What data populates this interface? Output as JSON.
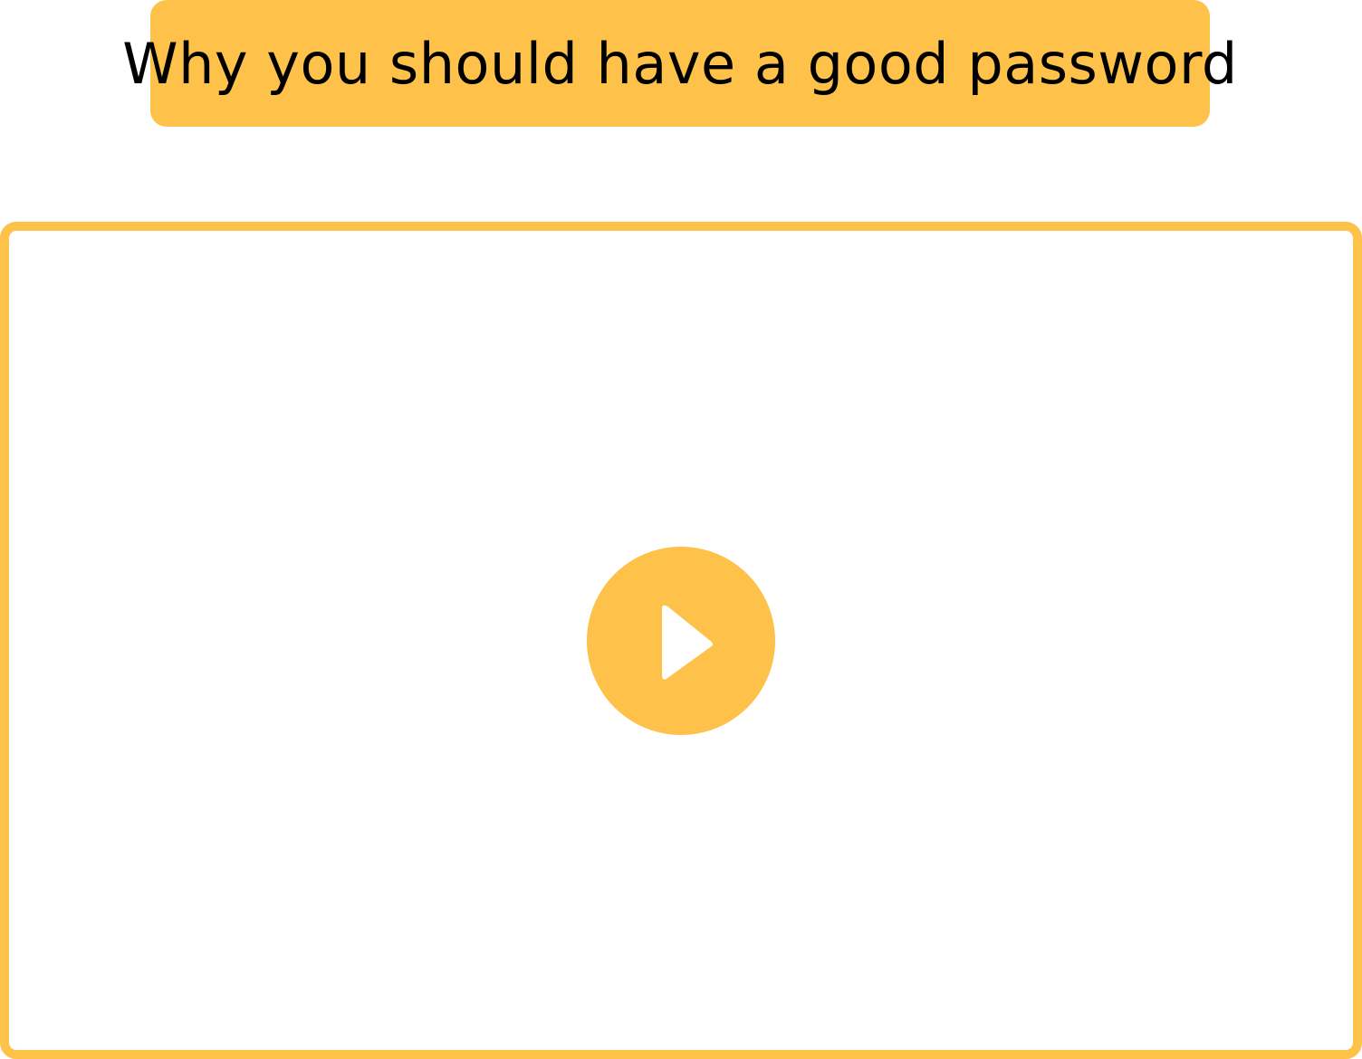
{
  "header": {
    "title": "Why you should have a good password"
  },
  "video": {
    "play_icon": "play-icon"
  },
  "colors": {
    "accent": "#FEC149",
    "background": "#FFFFFF",
    "text": "#000000"
  }
}
